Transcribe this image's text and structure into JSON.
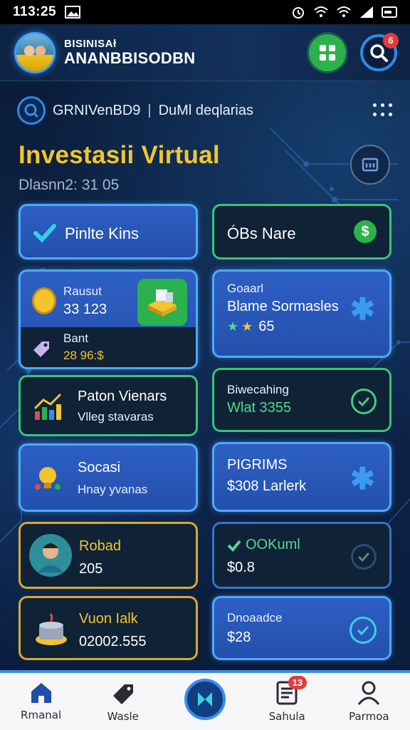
{
  "status_bar": {
    "time": "113:25"
  },
  "header": {
    "brand_small": "BISINISAł",
    "brand_big": "ANANBBISODBN",
    "search_badge": "6"
  },
  "subheader": {
    "left_text": "GRNIVenBD9",
    "right_text": "DuMl deqlarias"
  },
  "page": {
    "title": "Investasii Virtual",
    "subtitle": "Dlasnn2: 31 05"
  },
  "cards": {
    "pinte_kins": {
      "label": "Pinlte Kins"
    },
    "obs_nare": {
      "label": "ÓBs Nare"
    },
    "rausut": {
      "label": "Rausut",
      "value": "33 123",
      "sub_label": "Bant",
      "sub_value": "28 96:$"
    },
    "game_sormasles": {
      "top": "Goaarl",
      "label": "Blame Sormasles",
      "value": "65"
    },
    "paton": {
      "label": "Paton Vienars",
      "sub": "Vlleg stavaras"
    },
    "biwecaning": {
      "label": "Biwecahing",
      "value": "Wlat 3355"
    },
    "socasi": {
      "label": "Socasi",
      "sub": "Hnay yvanas"
    },
    "pigrims": {
      "label": "PIGRIMS",
      "value": "$308 Larlerk"
    },
    "robad": {
      "label": "Robad",
      "value": "205"
    },
    "ookum": {
      "label": "OOKuml",
      "value": "$0.8"
    },
    "vuon_taik": {
      "label": "Vuon Ialk",
      "value": "02002.555"
    },
    "dnoaadce": {
      "label": "Dnoaadce",
      "value": "$28"
    }
  },
  "bottom_nav": {
    "home": "Rmanal",
    "tasks": "Wasle",
    "schedule": "Sahula",
    "schedule_badge": "13",
    "profile": "Parmoa"
  },
  "colors": {
    "accent_blue": "#3a8bec",
    "gold": "#f3c52d",
    "green": "#38c47a"
  }
}
